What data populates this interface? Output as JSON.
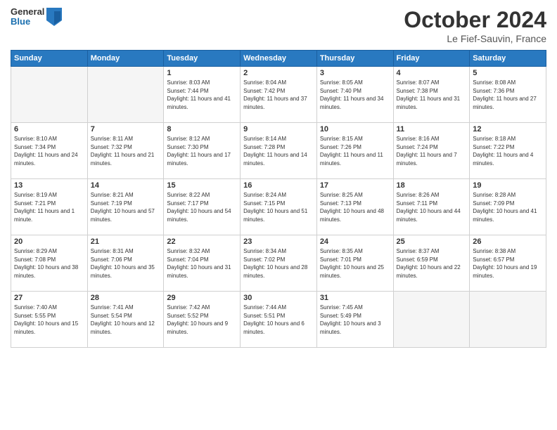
{
  "logo": {
    "general": "General",
    "blue": "Blue"
  },
  "title": "October 2024",
  "subtitle": "Le Fief-Sauvin, France",
  "headers": [
    "Sunday",
    "Monday",
    "Tuesday",
    "Wednesday",
    "Thursday",
    "Friday",
    "Saturday"
  ],
  "weeks": [
    [
      {
        "day": "",
        "sunrise": "",
        "sunset": "",
        "daylight": ""
      },
      {
        "day": "",
        "sunrise": "",
        "sunset": "",
        "daylight": ""
      },
      {
        "day": "1",
        "sunrise": "Sunrise: 8:03 AM",
        "sunset": "Sunset: 7:44 PM",
        "daylight": "Daylight: 11 hours and 41 minutes."
      },
      {
        "day": "2",
        "sunrise": "Sunrise: 8:04 AM",
        "sunset": "Sunset: 7:42 PM",
        "daylight": "Daylight: 11 hours and 37 minutes."
      },
      {
        "day": "3",
        "sunrise": "Sunrise: 8:05 AM",
        "sunset": "Sunset: 7:40 PM",
        "daylight": "Daylight: 11 hours and 34 minutes."
      },
      {
        "day": "4",
        "sunrise": "Sunrise: 8:07 AM",
        "sunset": "Sunset: 7:38 PM",
        "daylight": "Daylight: 11 hours and 31 minutes."
      },
      {
        "day": "5",
        "sunrise": "Sunrise: 8:08 AM",
        "sunset": "Sunset: 7:36 PM",
        "daylight": "Daylight: 11 hours and 27 minutes."
      }
    ],
    [
      {
        "day": "6",
        "sunrise": "Sunrise: 8:10 AM",
        "sunset": "Sunset: 7:34 PM",
        "daylight": "Daylight: 11 hours and 24 minutes."
      },
      {
        "day": "7",
        "sunrise": "Sunrise: 8:11 AM",
        "sunset": "Sunset: 7:32 PM",
        "daylight": "Daylight: 11 hours and 21 minutes."
      },
      {
        "day": "8",
        "sunrise": "Sunrise: 8:12 AM",
        "sunset": "Sunset: 7:30 PM",
        "daylight": "Daylight: 11 hours and 17 minutes."
      },
      {
        "day": "9",
        "sunrise": "Sunrise: 8:14 AM",
        "sunset": "Sunset: 7:28 PM",
        "daylight": "Daylight: 11 hours and 14 minutes."
      },
      {
        "day": "10",
        "sunrise": "Sunrise: 8:15 AM",
        "sunset": "Sunset: 7:26 PM",
        "daylight": "Daylight: 11 hours and 11 minutes."
      },
      {
        "day": "11",
        "sunrise": "Sunrise: 8:16 AM",
        "sunset": "Sunset: 7:24 PM",
        "daylight": "Daylight: 11 hours and 7 minutes."
      },
      {
        "day": "12",
        "sunrise": "Sunrise: 8:18 AM",
        "sunset": "Sunset: 7:22 PM",
        "daylight": "Daylight: 11 hours and 4 minutes."
      }
    ],
    [
      {
        "day": "13",
        "sunrise": "Sunrise: 8:19 AM",
        "sunset": "Sunset: 7:21 PM",
        "daylight": "Daylight: 11 hours and 1 minute."
      },
      {
        "day": "14",
        "sunrise": "Sunrise: 8:21 AM",
        "sunset": "Sunset: 7:19 PM",
        "daylight": "Daylight: 10 hours and 57 minutes."
      },
      {
        "day": "15",
        "sunrise": "Sunrise: 8:22 AM",
        "sunset": "Sunset: 7:17 PM",
        "daylight": "Daylight: 10 hours and 54 minutes."
      },
      {
        "day": "16",
        "sunrise": "Sunrise: 8:24 AM",
        "sunset": "Sunset: 7:15 PM",
        "daylight": "Daylight: 10 hours and 51 minutes."
      },
      {
        "day": "17",
        "sunrise": "Sunrise: 8:25 AM",
        "sunset": "Sunset: 7:13 PM",
        "daylight": "Daylight: 10 hours and 48 minutes."
      },
      {
        "day": "18",
        "sunrise": "Sunrise: 8:26 AM",
        "sunset": "Sunset: 7:11 PM",
        "daylight": "Daylight: 10 hours and 44 minutes."
      },
      {
        "day": "19",
        "sunrise": "Sunrise: 8:28 AM",
        "sunset": "Sunset: 7:09 PM",
        "daylight": "Daylight: 10 hours and 41 minutes."
      }
    ],
    [
      {
        "day": "20",
        "sunrise": "Sunrise: 8:29 AM",
        "sunset": "Sunset: 7:08 PM",
        "daylight": "Daylight: 10 hours and 38 minutes."
      },
      {
        "day": "21",
        "sunrise": "Sunrise: 8:31 AM",
        "sunset": "Sunset: 7:06 PM",
        "daylight": "Daylight: 10 hours and 35 minutes."
      },
      {
        "day": "22",
        "sunrise": "Sunrise: 8:32 AM",
        "sunset": "Sunset: 7:04 PM",
        "daylight": "Daylight: 10 hours and 31 minutes."
      },
      {
        "day": "23",
        "sunrise": "Sunrise: 8:34 AM",
        "sunset": "Sunset: 7:02 PM",
        "daylight": "Daylight: 10 hours and 28 minutes."
      },
      {
        "day": "24",
        "sunrise": "Sunrise: 8:35 AM",
        "sunset": "Sunset: 7:01 PM",
        "daylight": "Daylight: 10 hours and 25 minutes."
      },
      {
        "day": "25",
        "sunrise": "Sunrise: 8:37 AM",
        "sunset": "Sunset: 6:59 PM",
        "daylight": "Daylight: 10 hours and 22 minutes."
      },
      {
        "day": "26",
        "sunrise": "Sunrise: 8:38 AM",
        "sunset": "Sunset: 6:57 PM",
        "daylight": "Daylight: 10 hours and 19 minutes."
      }
    ],
    [
      {
        "day": "27",
        "sunrise": "Sunrise: 7:40 AM",
        "sunset": "Sunset: 5:55 PM",
        "daylight": "Daylight: 10 hours and 15 minutes."
      },
      {
        "day": "28",
        "sunrise": "Sunrise: 7:41 AM",
        "sunset": "Sunset: 5:54 PM",
        "daylight": "Daylight: 10 hours and 12 minutes."
      },
      {
        "day": "29",
        "sunrise": "Sunrise: 7:42 AM",
        "sunset": "Sunset: 5:52 PM",
        "daylight": "Daylight: 10 hours and 9 minutes."
      },
      {
        "day": "30",
        "sunrise": "Sunrise: 7:44 AM",
        "sunset": "Sunset: 5:51 PM",
        "daylight": "Daylight: 10 hours and 6 minutes."
      },
      {
        "day": "31",
        "sunrise": "Sunrise: 7:45 AM",
        "sunset": "Sunset: 5:49 PM",
        "daylight": "Daylight: 10 hours and 3 minutes."
      },
      {
        "day": "",
        "sunrise": "",
        "sunset": "",
        "daylight": ""
      },
      {
        "day": "",
        "sunrise": "",
        "sunset": "",
        "daylight": ""
      }
    ]
  ]
}
